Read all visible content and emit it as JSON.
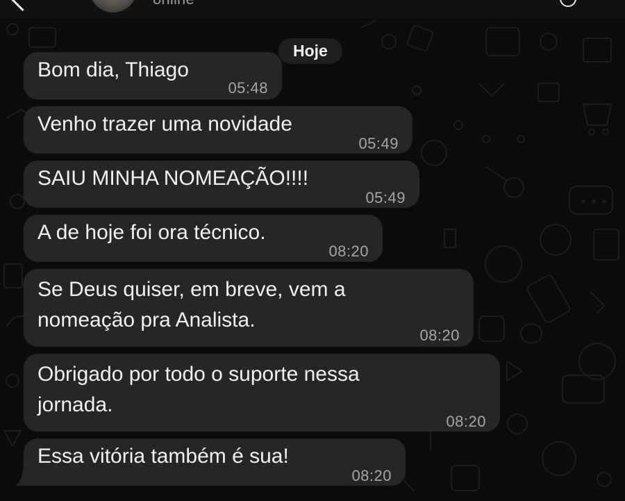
{
  "header": {
    "status": "online",
    "avatar_alt": "contact avatar"
  },
  "date_separator": "Hoje",
  "messages": [
    {
      "text": "Bom dia, Thiago",
      "time": "05:48"
    },
    {
      "text": "Venho trazer uma novidade",
      "time": "05:49"
    },
    {
      "text": "SAIU MINHA NOMEAÇÃO!!!!",
      "time": "05:49"
    },
    {
      "text": "A de hoje foi ora técnico.",
      "time": "08:20"
    },
    {
      "text": "Se Deus quiser, em breve, vem a\nnomeação pra Analista.",
      "time": "08:20"
    },
    {
      "text": "Obrigado por todo o suporte nessa\njornada.",
      "time": "08:20"
    },
    {
      "text": "Essa vitória também é sua!",
      "time": "08:20"
    }
  ],
  "colors": {
    "background": "#0c0c0c",
    "bubble": "#262626",
    "text": "#f1f1f1",
    "timestamp": "#a6a6a6",
    "doodle": "#1c1c1c"
  }
}
